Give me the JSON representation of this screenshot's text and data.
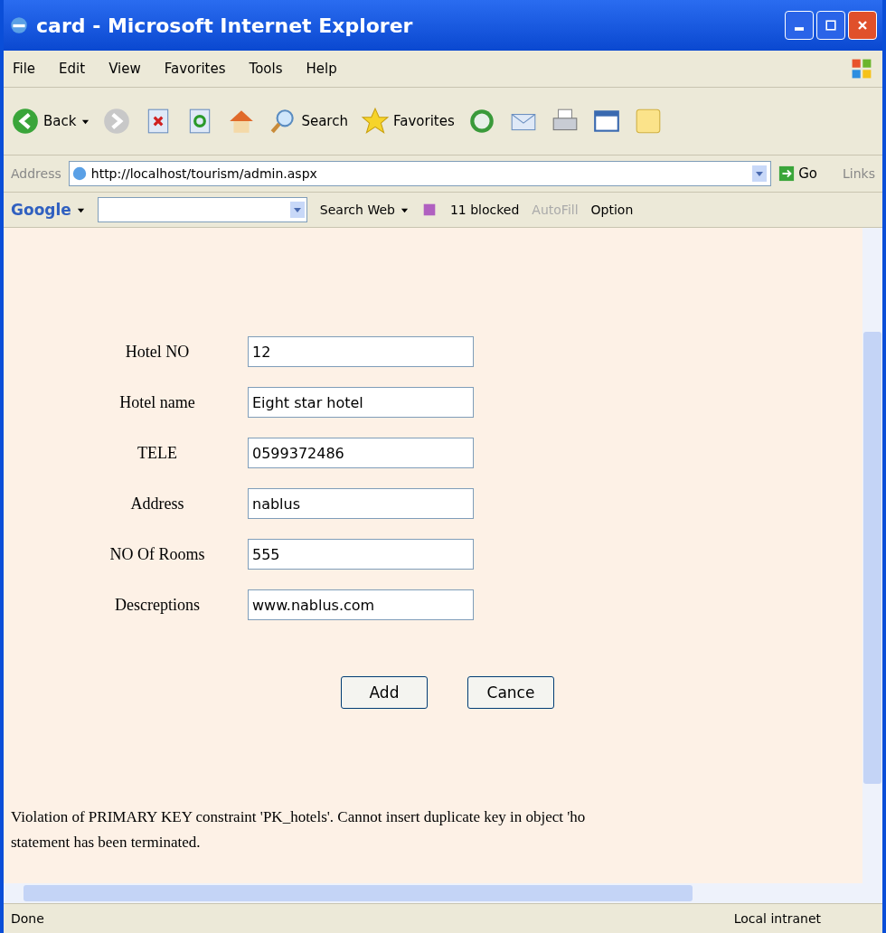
{
  "window": {
    "title": "card - Microsoft Internet Explorer"
  },
  "menu": [
    "File",
    "Edit",
    "View",
    "Favorites",
    "Tools",
    "Help"
  ],
  "toolbar": {
    "back": "Back",
    "search": "Search",
    "favorites": "Favorites"
  },
  "address_bar": {
    "label": "Address",
    "url": "http://localhost/tourism/admin.aspx",
    "go": "Go",
    "links": "Links"
  },
  "google_bar": {
    "logo": "Google",
    "search_web": "Search Web",
    "blocked": "11 blocked",
    "autofill": "AutoFill",
    "options": "Option"
  },
  "form": {
    "fields": [
      {
        "label": "Hotel NO",
        "value": "12"
      },
      {
        "label": "Hotel name",
        "value": "Eight star hotel"
      },
      {
        "label": "TELE",
        "value": "0599372486"
      },
      {
        "label": "Address",
        "value": "nablus"
      },
      {
        "label": "NO Of Rooms",
        "value": "555"
      },
      {
        "label": "Descreptions",
        "value": "www.nablus.com"
      }
    ],
    "buttons": [
      "Add",
      "Cance"
    ]
  },
  "error_lines": [
    "Violation of PRIMARY KEY constraint 'PK_hotels'. Cannot insert duplicate key in object 'ho",
    "statement has been terminated."
  ],
  "status_bar": {
    "text": "Done",
    "zone": "Local intranet"
  }
}
